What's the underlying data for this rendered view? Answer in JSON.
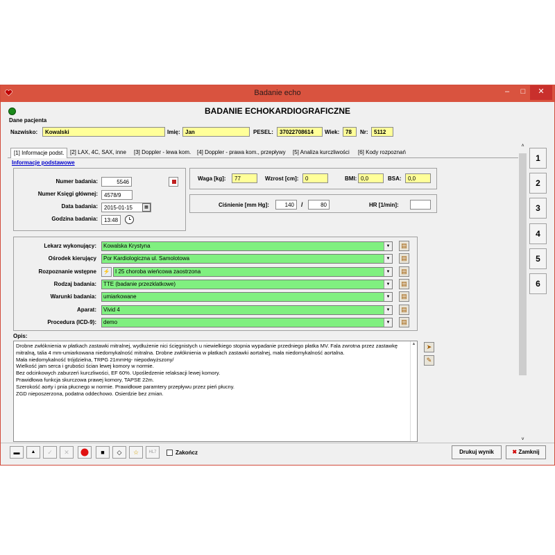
{
  "window": {
    "title": "Badanie echo",
    "min_label": "–",
    "max_label": "□",
    "close_label": "✕"
  },
  "header": {
    "title": "BADANIE ECHOKARDIOGRAFICZNE"
  },
  "patient": {
    "section_label": "Dane pacjenta",
    "surname_label": "Nazwisko:",
    "surname": "Kowalski",
    "firstname_label": "Imię:",
    "firstname": "Jan",
    "pesel_label": "PESEL:",
    "pesel": "37022708614",
    "age_label": "Wiek:",
    "age": "78",
    "nr_label": "Nr:",
    "nr": "5112"
  },
  "tabs": [
    "[1] Informacje podst.",
    "[2] LAX, 4C, SAX, inne",
    "[3] Doppler - lewa kom.",
    "[4] Doppler - prawa kom., przepływy",
    "[5] Analiza kurczliwości",
    "[6] Kody rozpoznań"
  ],
  "section_link": "Informacje podstawowe",
  "basic": {
    "exam_no_label": "Numer badania:",
    "exam_no": "5546",
    "book_no_label": "Numer Księgi głównej:",
    "book_no": "4578/9",
    "date_label": "Data badania:",
    "date": "2015-01-15",
    "time_label": "Godzina badania:",
    "time": "13:48"
  },
  "measures": {
    "weight_label": "Waga [kg]:",
    "weight": "77",
    "height_label": "Wzrost [cm]:",
    "height": "0",
    "bmi_label": "BMI:",
    "bmi": "0,0",
    "bsa_label": "BSA:",
    "bsa": "0,0",
    "bp_label": "Ciśnienie [mm Hg]:",
    "bp_sys": "140",
    "bp_sep": "/",
    "bp_dia": "80",
    "hr_label": "HR [1/min]:",
    "hr": ""
  },
  "details": [
    {
      "label": "Lekarz wykonujący:",
      "value": "Kowalska  Krystyna"
    },
    {
      "label": "Ośrodek kierujący",
      "value": "Por Kardiologiczna ul. Samolotowa"
    },
    {
      "label": "Rozpoznanie wstępne",
      "value": "I  25  choroba wieńcowa zaostrzona"
    },
    {
      "label": "Rodzaj badania:",
      "value": "TTE (badanie przezklatkowe)"
    },
    {
      "label": "Warunki badania:",
      "value": "umiarkowane"
    },
    {
      "label": "Aparat:",
      "value": "Vivid 4"
    },
    {
      "label": "Procedura (ICD-9):",
      "value": "demo"
    }
  ],
  "description": {
    "label": "Opis:",
    "lines": [
      "Drobne zwłóknienia w płatkach zastawki mitralnej, wydłużenie nici ścięgnistych u niewielkiego stopnia wypadanie przedniego płatka MV. Fala zwrotna przez zastawkę mitralną, talia 4 mm-umiarkowana niedomykalność mitralna. Drobne zwłóknienia w płatkach zastawki aortalnej, mała niedomykalność aortalna.",
      "Mała niedomykalność trójdzielna, TRPG 21mmHg- niepodwyższony/",
      "Wielkość jam serca i grubości ścian lewej komory w normie.",
      "Bez odcinkowych zaburzeń kurczliwości, EF 60%. Upośledzenie relaksacji lewej komory.",
      "Prawidłowa funkcja skurczowa prawej komory, TAPSE 22m.",
      "Szerokość aorty i pnia płucnego w normie. Prawidłowe paramtery przepływu przez pień płucny.",
      "ZGD nieposzerzona, podatna oddechowo. Osierdzie bez zmian."
    ]
  },
  "side_buttons": [
    "1",
    "2",
    "3",
    "4",
    "5",
    "6"
  ],
  "toolbar": {
    "finish_label": "Zakończ",
    "hl7_label": "HL7",
    "print_label": "Drukuj wynik",
    "close_label": "Zamknij"
  }
}
